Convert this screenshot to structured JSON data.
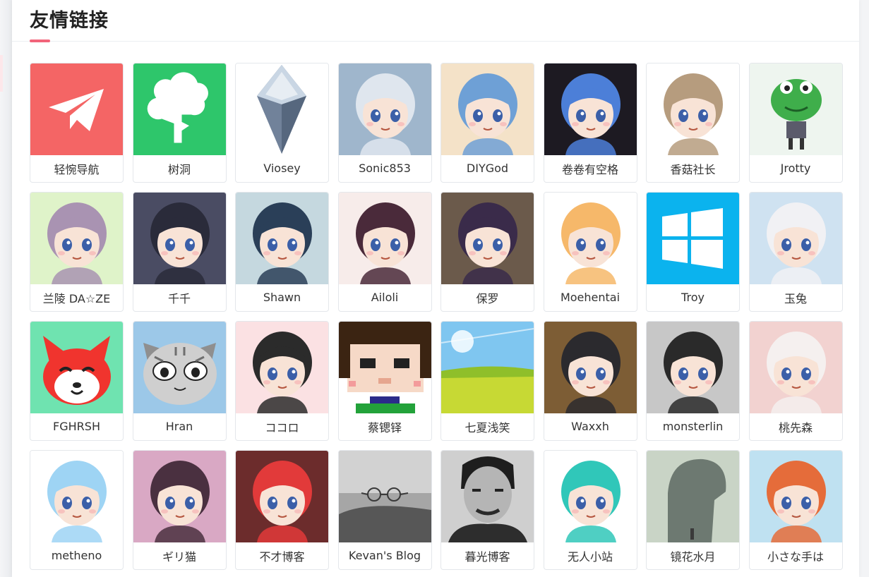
{
  "section": {
    "title": "友情链接",
    "accent_color": "#f2647a"
  },
  "links": [
    {
      "name": "轻惋导航",
      "icon": "paper-plane-icon",
      "bg": "#f46565",
      "fg": "#ffffff"
    },
    {
      "name": "树洞",
      "icon": "tree-icon",
      "bg": "#2ec66b",
      "fg": "#ffffff"
    },
    {
      "name": "Viosey",
      "icon": "crystal-logo-icon",
      "bg": "#ffffff",
      "fg": "#5e7086"
    },
    {
      "name": "Sonic853",
      "icon": "anime-avatar-icon",
      "bg": "#9fb6cc",
      "fg": "#dfe6ee"
    },
    {
      "name": "DIYGod",
      "icon": "anime-avatar-icon",
      "bg": "#f4e2c8",
      "fg": "#6ea0d6"
    },
    {
      "name": "卷卷有空格",
      "icon": "anime-avatar-icon",
      "bg": "#1d1a22",
      "fg": "#4c7fd8"
    },
    {
      "name": "香菇社长",
      "icon": "anime-avatar-icon",
      "bg": "#ffffff",
      "fg": "#b69c7e"
    },
    {
      "name": "Jrotty",
      "icon": "frog-avatar-icon",
      "bg": "#eef5ef",
      "fg": "#3fae4b"
    },
    {
      "name": "兰陵 DA☆ZE",
      "icon": "anime-avatar-icon",
      "bg": "#dff3c9",
      "fg": "#a993b2"
    },
    {
      "name": "千千",
      "icon": "anime-avatar-icon",
      "bg": "#4a4c63",
      "fg": "#2a2b3a"
    },
    {
      "name": "Shawn",
      "icon": "anime-avatar-icon",
      "bg": "#c5d8df",
      "fg": "#2a3f58"
    },
    {
      "name": "Ailoli",
      "icon": "anime-avatar-icon",
      "bg": "#f7ecea",
      "fg": "#4a2a3a"
    },
    {
      "name": "保罗",
      "icon": "anime-avatar-icon",
      "bg": "#6b5a4b",
      "fg": "#3a2b4a"
    },
    {
      "name": "Moehentai",
      "icon": "anime-avatar-icon",
      "bg": "#ffffff",
      "fg": "#f6b86a"
    },
    {
      "name": "Troy",
      "icon": "windows-logo-icon",
      "bg": "#0bb3ee",
      "fg": "#ffffff"
    },
    {
      "name": "玉兔",
      "icon": "anime-avatar-icon",
      "bg": "#cfe2f1",
      "fg": "#f1f1f4"
    },
    {
      "name": "FGHRSH",
      "icon": "fox-avatar-icon",
      "bg": "#6fe3b0",
      "fg": "#f0342e"
    },
    {
      "name": "Hran",
      "icon": "cat-avatar-icon",
      "bg": "#9cc8e8",
      "fg": "#8f8f8f"
    },
    {
      "name": "ココロ",
      "icon": "anime-avatar-icon",
      "bg": "#fbe1e3",
      "fg": "#2b2b2b"
    },
    {
      "name": "蔡锶铎",
      "icon": "pixel-avatar-icon",
      "bg": "#ffffff",
      "fg": "#3b2412"
    },
    {
      "name": "七夏浅笑",
      "icon": "landscape-icon",
      "bg": "#7fc6f0",
      "fg": "#c7d934"
    },
    {
      "name": "Waxxh",
      "icon": "anime-avatar-icon",
      "bg": "#7d5d35",
      "fg": "#2b2a2e"
    },
    {
      "name": "monsterlin",
      "icon": "anime-avatar-icon",
      "bg": "#c7c7c7",
      "fg": "#2a2a2a"
    },
    {
      "name": "桃先森",
      "icon": "anime-avatar-icon",
      "bg": "#f2d2d0",
      "fg": "#f5f0ef"
    },
    {
      "name": "metheno",
      "icon": "anime-avatar-icon",
      "bg": "#ffffff",
      "fg": "#9ed4f4"
    },
    {
      "name": "ギリ猫",
      "icon": "anime-avatar-icon",
      "bg": "#d9a8c4",
      "fg": "#4a3040"
    },
    {
      "name": "不才博客",
      "icon": "anime-avatar-icon",
      "bg": "#6c2c2c",
      "fg": "#e23a3a"
    },
    {
      "name": "Kevan's Blog",
      "icon": "glasses-photo-icon",
      "bg": "#a6a6a6",
      "fg": "#3a3a3a"
    },
    {
      "name": "暮光博客",
      "icon": "portrait-photo-icon",
      "bg": "#cfcfcf",
      "fg": "#2a2a2a"
    },
    {
      "name": "无人小站",
      "icon": "anime-avatar-icon",
      "bg": "#ffffff",
      "fg": "#30c7b9"
    },
    {
      "name": "镜花水月",
      "icon": "silhouette-icon",
      "bg": "#c9d4c6",
      "fg": "#56615b"
    },
    {
      "name": "小さな手は",
      "icon": "anime-avatar-icon",
      "bg": "#bfe1f1",
      "fg": "#e56c3a"
    }
  ]
}
